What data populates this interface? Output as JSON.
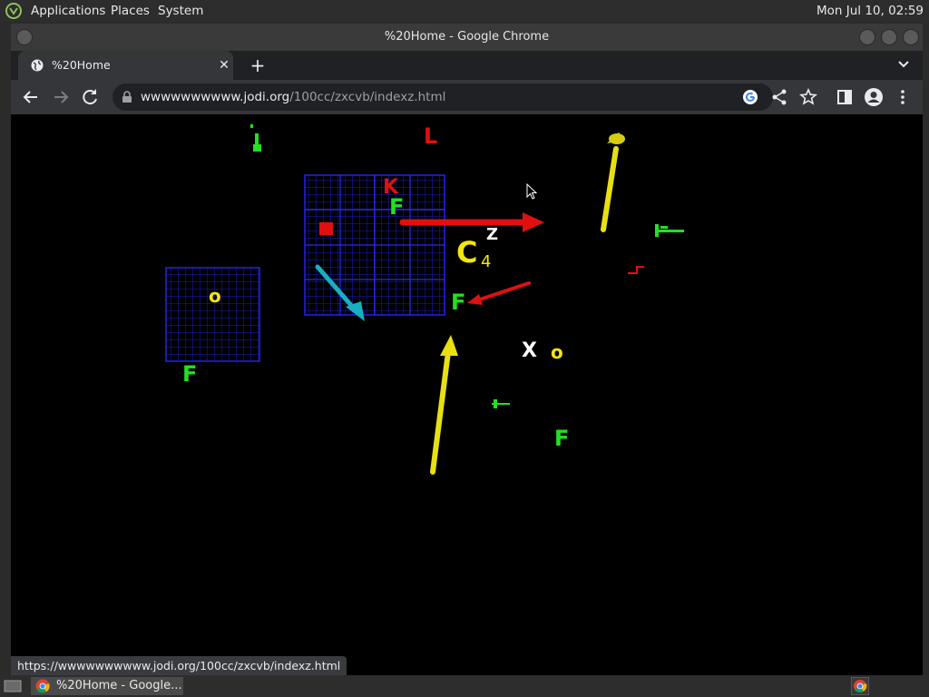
{
  "top_panel": {
    "menus": [
      "Applications",
      "Places",
      "System"
    ],
    "clock": "Mon Jul 10, 02:59"
  },
  "window": {
    "title": "%20Home - Google Chrome",
    "tab_title": "%20Home",
    "url_domain": "wwwwwwwwww.jodi.org",
    "url_path": "/100cc/zxcvb/indexz.html",
    "status_url": "https://wwwwwwwwww.jodi.org/100cc/zxcvb/indexz.html"
  },
  "page": {
    "letters": [
      {
        "id": "L",
        "text": "L",
        "color": "#e01010"
      },
      {
        "id": "K",
        "text": "K",
        "color": "#e01010"
      },
      {
        "id": "F1",
        "text": "F",
        "color": "#22e022"
      },
      {
        "id": "C",
        "text": "C",
        "color": "#f5e60a"
      },
      {
        "id": "4",
        "text": "4",
        "color": "#f5e60a"
      },
      {
        "id": "Z",
        "text": "Z",
        "color": "#ffffff"
      },
      {
        "id": "F2",
        "text": "F",
        "color": "#22e022"
      },
      {
        "id": "o1",
        "text": "o",
        "color": "#f5e60a"
      },
      {
        "id": "F3",
        "text": "F",
        "color": "#22e022"
      },
      {
        "id": "X",
        "text": "X",
        "color": "#ffffff"
      },
      {
        "id": "o2",
        "text": "o",
        "color": "#f5e60a"
      },
      {
        "id": "F4",
        "text": "F",
        "color": "#22e022"
      }
    ]
  },
  "taskbar": {
    "task_label": "%20Home - Google..."
  },
  "colors": {
    "grid_blue": "#1a1acc",
    "arrow_red": "#e01010",
    "arrow_yellow": "#e8e010",
    "arrow_cyan": "#18b0c0",
    "green": "#22e022"
  }
}
